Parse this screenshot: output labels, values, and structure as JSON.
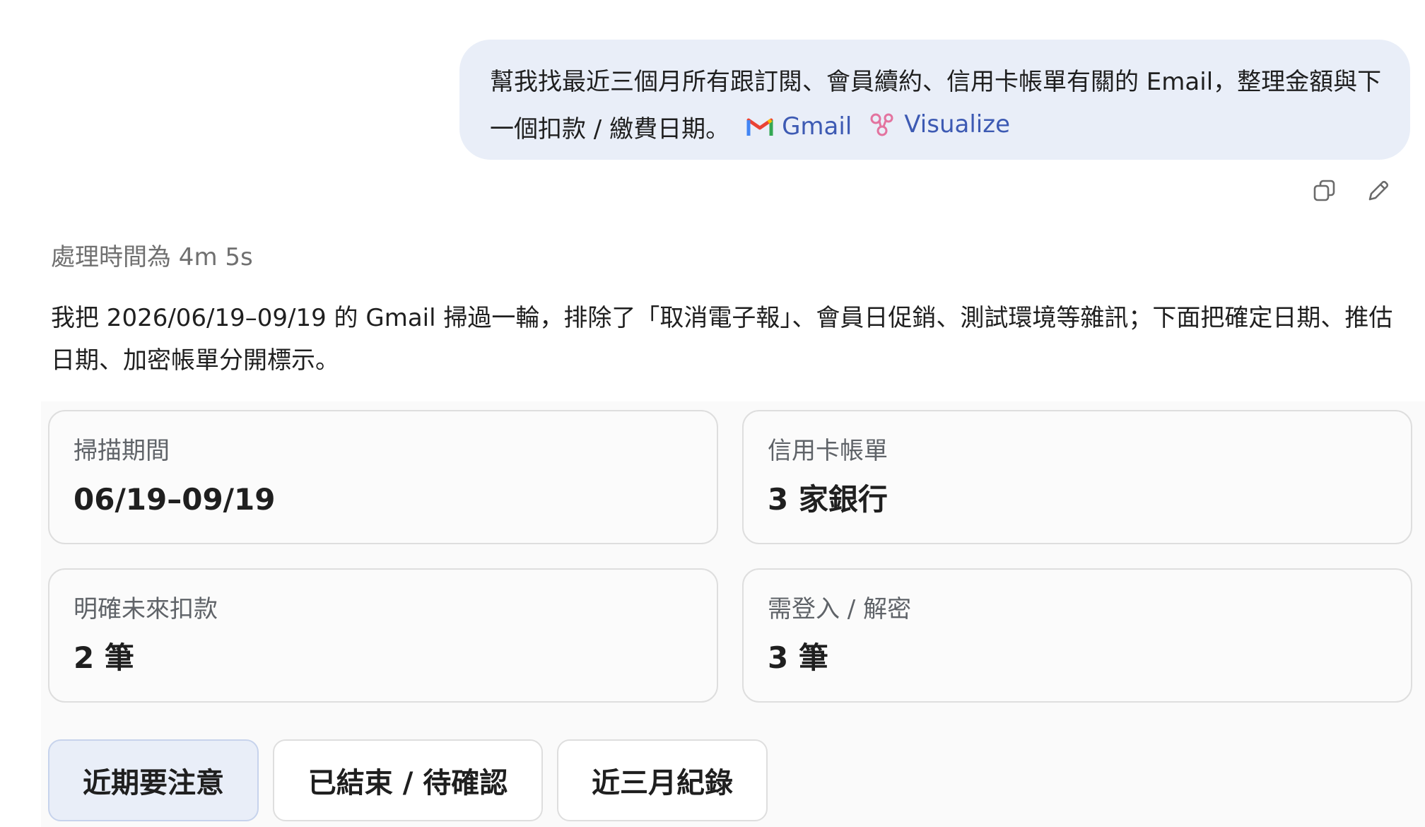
{
  "user_message": {
    "text": "幫我找最近三個月所有跟訂閱、會員續約、信用卡帳單有關的 Email，整理金額與下一個扣款 / 繳費日期。",
    "tools": [
      {
        "label": "Gmail",
        "icon": "gmail-icon"
      },
      {
        "label": "Visualize",
        "icon": "visualize-icon"
      }
    ]
  },
  "message_actions": {
    "copy": "copy-icon",
    "edit": "edit-icon"
  },
  "assistant": {
    "thinking_label": "處理時間為 4m 5s",
    "intro": "我把 2026/06/19–09/19 的 Gmail 掃過一輪，排除了「取消電子報」、會員日促銷、測試環境等雜訊；下面把確定日期、推估日期、加密帳單分開標示。"
  },
  "stats": [
    {
      "label": "掃描期間",
      "value": "06/19–09/19"
    },
    {
      "label": "信用卡帳單",
      "value": "3 家銀行"
    },
    {
      "label": "明確未來扣款",
      "value": "2 筆"
    },
    {
      "label": "需登入 / 解密",
      "value": "3 筆"
    }
  ],
  "tabs": [
    {
      "label": "近期要注意",
      "active": true
    },
    {
      "label": "已結束 / 待確認",
      "active": false
    },
    {
      "label": "近三月紀錄",
      "active": false
    }
  ],
  "colors": {
    "accent": "#3d5ab3",
    "bubble": "#e9eef8",
    "visualize": "#e3739f"
  }
}
